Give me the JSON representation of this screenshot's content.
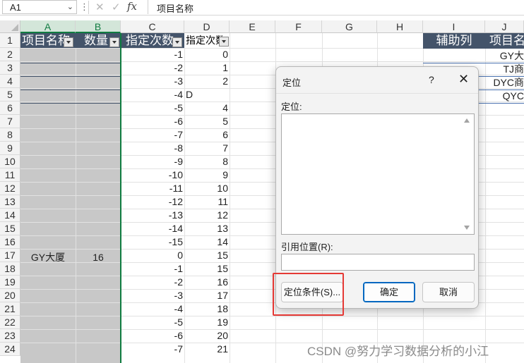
{
  "formula_bar": {
    "name_box": "A1",
    "fx_label": "fx",
    "formula_value": "项目名称"
  },
  "columns": [
    "A",
    "B",
    "C",
    "D",
    "E",
    "F",
    "G",
    "H",
    "I",
    "J"
  ],
  "rows": [
    "1",
    "2",
    "3",
    "4",
    "5",
    "6",
    "7",
    "8",
    "9",
    "10",
    "11",
    "12",
    "13",
    "14",
    "15",
    "16",
    "17",
    "18",
    "19",
    "20",
    "21",
    "22",
    "23",
    "24"
  ],
  "table_headers": {
    "a": "项目名称",
    "b": "数量",
    "c": "指定次数",
    "d": "指定次数"
  },
  "col_c_values": [
    "-1",
    "-2",
    "-3",
    "-4",
    "-5",
    "-6",
    "-7",
    "-8",
    "-9",
    "-10",
    "-11",
    "-12",
    "-13",
    "-14",
    "-15",
    "0",
    "-1",
    "-2",
    "-3",
    "-4",
    "-5",
    "-6",
    "-7"
  ],
  "col_d_values": [
    "0",
    "1",
    "2",
    "D",
    "4",
    "5",
    "6",
    "7",
    "8",
    "9",
    "10",
    "11",
    "12",
    "13",
    "14",
    "15",
    "15",
    "16",
    "17",
    "18",
    "19",
    "20",
    "21"
  ],
  "row17": {
    "a": "GY大厦",
    "b": "16"
  },
  "helper_table": {
    "col_i_header": "辅助列",
    "col_j_header": "项目名",
    "j_values": [
      "GY大",
      "TJ商",
      "DYC商",
      "QYC"
    ]
  },
  "dialog": {
    "title": "定位",
    "help": "?",
    "close": "✕",
    "goto_label": "定位:",
    "reference_label": "引用位置(R):",
    "special_button": "定位条件(S)...",
    "ok_button": "确定",
    "cancel_button": "取消"
  },
  "watermark": "CSDN @努力学习数据分析的小江"
}
